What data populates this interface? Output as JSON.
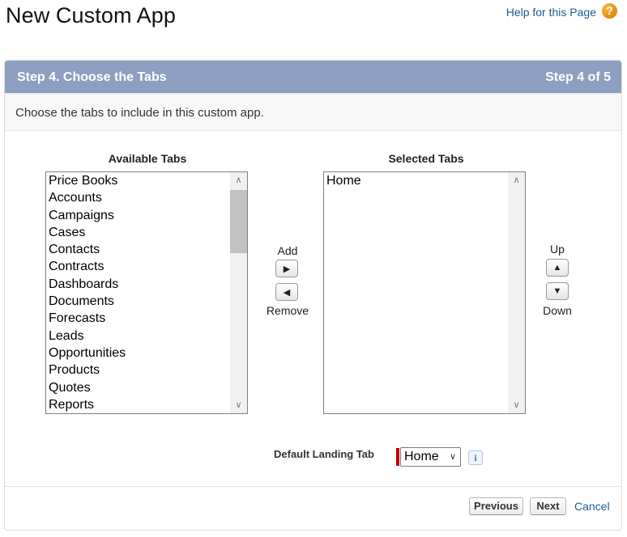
{
  "page": {
    "title": "New Custom App",
    "help_link": "Help for this Page",
    "help_icon": "?"
  },
  "wizard": {
    "step_title": "Step 4. Choose the Tabs",
    "step_count": "Step 4 of 5",
    "description": "Choose the tabs to include in this custom app."
  },
  "available": {
    "label": "Available Tabs",
    "items": [
      "Price Books",
      "Accounts",
      "Campaigns",
      "Cases",
      "Contacts",
      "Contracts",
      "Dashboards",
      "Documents",
      "Forecasts",
      "Leads",
      "Opportunities",
      "Products",
      "Quotes",
      "Reports"
    ]
  },
  "selected": {
    "label": "Selected Tabs",
    "items": [
      "Home"
    ]
  },
  "controls": {
    "add_label": "Add",
    "remove_label": "Remove",
    "up_label": "Up",
    "down_label": "Down"
  },
  "landing": {
    "label": "Default Landing Tab",
    "value": "Home",
    "info_icon": "i"
  },
  "footer": {
    "previous": "Previous",
    "next": "Next",
    "cancel": "Cancel"
  },
  "colors": {
    "header_bg": "#8da0c1",
    "link": "#1f5a92",
    "required": "#c00000",
    "help_icon": "#e18d0c"
  },
  "icons": {
    "help": "help-icon",
    "add": "arrow-right-icon",
    "remove": "arrow-left-icon",
    "up": "arrow-up-icon",
    "down": "arrow-down-icon",
    "info": "info-icon",
    "select_chevron": "chevron-down-icon"
  }
}
